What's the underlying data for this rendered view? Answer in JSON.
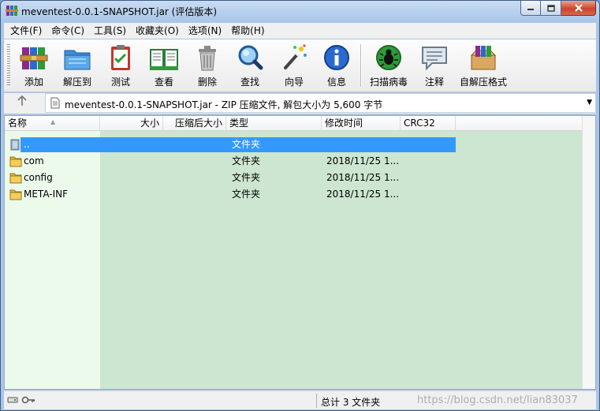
{
  "window": {
    "title": "meventest-0.0.1-SNAPSHOT.jar (评估版本)"
  },
  "menu": [
    {
      "id": "file",
      "label": "文件(F)"
    },
    {
      "id": "commands",
      "label": "命令(C)"
    },
    {
      "id": "tools",
      "label": "工具(S)"
    },
    {
      "id": "favorites",
      "label": "收藏夹(O)"
    },
    {
      "id": "options",
      "label": "选项(N)"
    },
    {
      "id": "help",
      "label": "帮助(H)"
    }
  ],
  "toolbar": {
    "add": "添加",
    "extract": "解压到",
    "test": "测试",
    "view": "查看",
    "delete": "删除",
    "find": "查找",
    "wizard": "向导",
    "info": "信息",
    "scan": "扫描病毒",
    "comment": "注释",
    "sfx": "自解压格式"
  },
  "address": {
    "path": "meventest-0.0.1-SNAPSHOT.jar - ZIP 压缩文件, 解包大小为 5,600 字节"
  },
  "columns": {
    "name": "名称",
    "size": "大小",
    "packed": "压缩后大小",
    "type": "类型",
    "modified": "修改时间",
    "crc": "CRC32"
  },
  "rows": [
    {
      "name": "..",
      "size": "",
      "packed": "",
      "type": "文件夹",
      "modified": "",
      "crc": ""
    },
    {
      "name": "com",
      "size": "",
      "packed": "",
      "type": "文件夹",
      "modified": "2018/11/25 1...",
      "crc": ""
    },
    {
      "name": "config",
      "size": "",
      "packed": "",
      "type": "文件夹",
      "modified": "2018/11/25 1...",
      "crc": ""
    },
    {
      "name": "META-INF",
      "size": "",
      "packed": "",
      "type": "文件夹",
      "modified": "2018/11/25 1...",
      "crc": ""
    }
  ],
  "status": {
    "summary": "总计 3 文件夹",
    "watermark": "https://blog.csdn.net/lian83037"
  }
}
